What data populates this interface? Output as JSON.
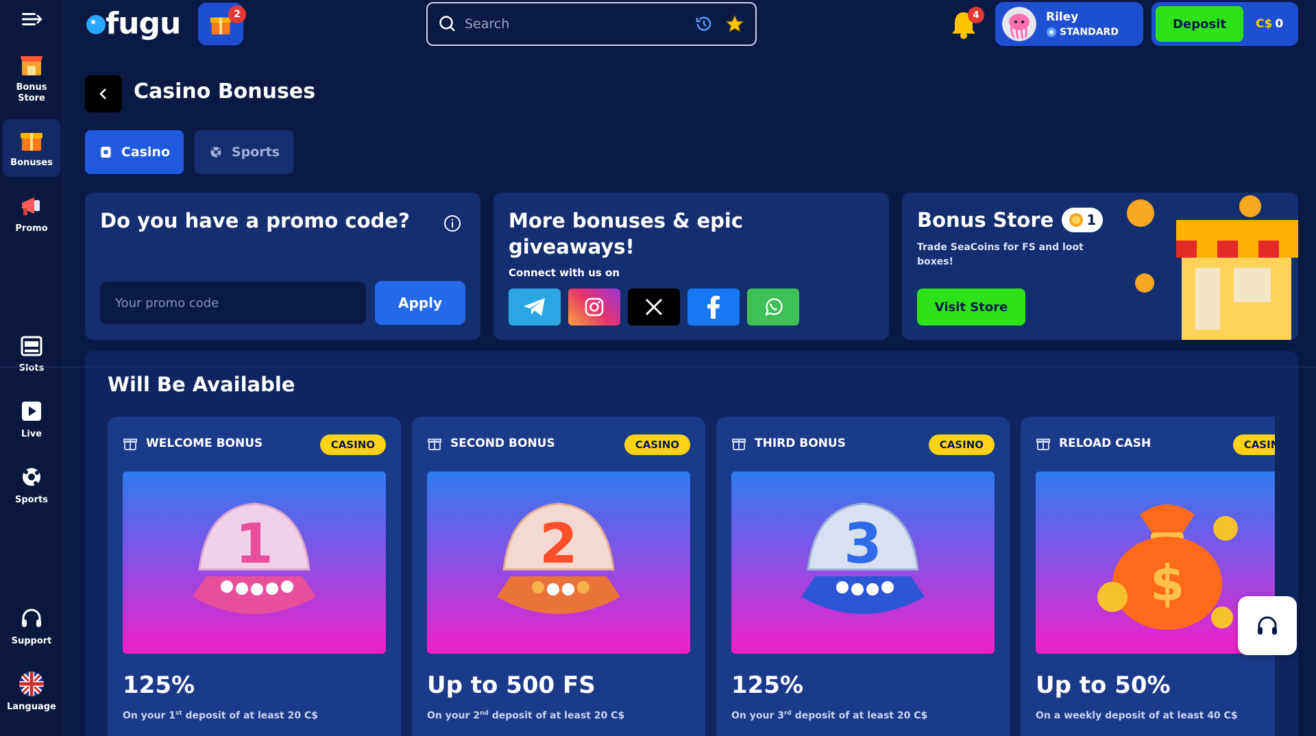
{
  "brand": {
    "logo_text": "fugu"
  },
  "header": {
    "gift_badge": "2",
    "search_placeholder": "Search",
    "notifications_badge": "4",
    "user": {
      "name": "Riley",
      "tier": "STANDARD"
    },
    "wallet": {
      "deposit_label": "Deposit",
      "currency": "C$",
      "amount": "0"
    }
  },
  "sidebar": {
    "items": [
      {
        "label": "Bonus\nStore",
        "icon": "shop-icon"
      },
      {
        "label": "Bonuses",
        "icon": "gift-icon"
      },
      {
        "label": "Promo",
        "icon": "megaphone-icon"
      },
      {
        "label": "Slots",
        "icon": "slot-machine-icon"
      },
      {
        "label": "Live",
        "icon": "play-icon"
      },
      {
        "label": "Sports",
        "icon": "ball-icon"
      },
      {
        "label": "Support",
        "icon": "headset-icon"
      },
      {
        "label": "Language",
        "icon": "uk-flag-icon"
      }
    ]
  },
  "page": {
    "title": "Casino Bonuses",
    "tabs": [
      {
        "label": "Casino"
      },
      {
        "label": "Sports"
      }
    ]
  },
  "promo": {
    "title": "Do you have a promo code?",
    "placeholder": "Your promo code",
    "apply_label": "Apply"
  },
  "social": {
    "title": "More bonuses & epic giveaways!",
    "connect_label": "Connect with us on",
    "networks": [
      "telegram",
      "instagram",
      "x",
      "facebook",
      "whatsapp"
    ]
  },
  "store": {
    "title": "Bonus Store",
    "coins": "1",
    "description": "Trade SeaCoins for FS and loot boxes!",
    "visit_label": "Visit Store"
  },
  "available": {
    "title": "Will Be Available",
    "cards": [
      {
        "name": "WELCOME BONUS",
        "tag": "CASINO",
        "number": "1",
        "amount": "125%",
        "desc_pre": "On your 1",
        "desc_sup": "st",
        "desc_post": " deposit of at least 20 C$"
      },
      {
        "name": "SECOND BONUS",
        "tag": "CASINO",
        "number": "2",
        "amount": "Up to 500 FS",
        "desc_pre": "On your 2",
        "desc_sup": "nd",
        "desc_post": " deposit of at least 20 C$"
      },
      {
        "name": "THIRD BONUS",
        "tag": "CASINO",
        "number": "3",
        "amount": "125%",
        "desc_pre": "On your 3",
        "desc_sup": "rd",
        "desc_post": " deposit of at least 20 C$"
      },
      {
        "name": "RELOAD CASH",
        "tag": "CASINO",
        "number": "",
        "amount": "Up to 50%",
        "desc_pre": "On a weekly deposit of at least 40 C$",
        "desc_sup": "",
        "desc_post": ""
      }
    ]
  },
  "colors": {
    "background": "#0b1a45",
    "accent_blue": "#2059dd",
    "deposit_green": "#2ee21a",
    "tag_yellow": "#ffd21a"
  }
}
